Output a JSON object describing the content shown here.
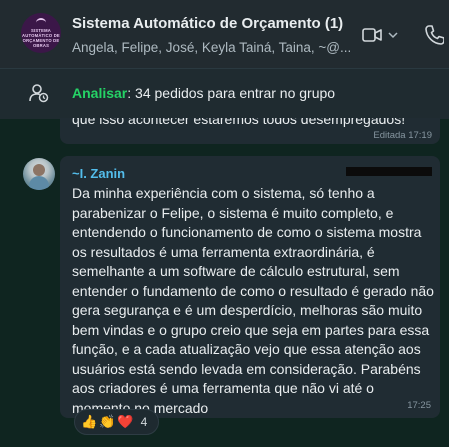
{
  "header": {
    "avatar_text": "SISTEMA AUTOMÁTICO DE ORÇAMENTO DE OBRAS",
    "title": "Sistema Automático de Orçamento (1)",
    "subtitle": "Angela, Felipe, José, Keyla Tainá, Taina, ~@...",
    "video_icon": "video-camera-icon",
    "chevron_icon": "chevron-down-icon",
    "call_icon": "phone-icon"
  },
  "banner": {
    "icon": "pending-members-icon",
    "action_label": "Analisar",
    "text": ": 34 pedidos para entrar no grupo"
  },
  "previous_message": {
    "text": "que isso acontecer estaremos todos desempregados!",
    "time": "Editada 17:19"
  },
  "message": {
    "sender": "~I. Zanin",
    "text": "Da minha experiência com o sistema, só tenho a parabenizar o Felipe, o sistema é muito completo, e entendendo o funcionamento de como o sistema mostra os resultados é uma ferramenta extraordinária, é semelhante a um software de cálculo estrutural, sem entender o fundamento de como o resultado é gerado não gera segurança e é um desperdício, melhoras são muito bem vindas e o grupo creio que seja em partes para essa função, e a cada atualização vejo que essa atenção aos usuários está sendo levada em consideração. Parabéns aos criadores é uma ferramenta que não vi até o momento no mercado",
    "time": "17:25",
    "reactions": [
      "👍",
      "👏",
      "❤️"
    ],
    "reaction_count": "4"
  },
  "colors": {
    "chat_bg": "#0f2520",
    "header_bg": "#222b30",
    "bubble_bg": "#202c33",
    "accent_green": "#25d366",
    "sender_blue": "#53bdeb"
  }
}
